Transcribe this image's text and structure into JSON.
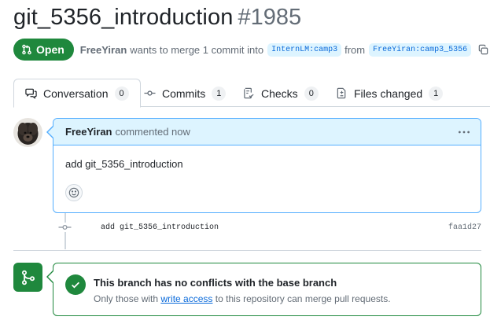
{
  "pr": {
    "title": "git_5356_introduction",
    "number": "#1985",
    "state": "Open",
    "author": "FreeYiran",
    "merge_text": "wants to merge 1 commit into",
    "base_branch": "InternLM:camp3",
    "from_text": "from",
    "head_branch": "FreeYiran:camp3_5356"
  },
  "tabs": [
    {
      "label": "Conversation",
      "count": "0"
    },
    {
      "label": "Commits",
      "count": "1"
    },
    {
      "label": "Checks",
      "count": "0"
    },
    {
      "label": "Files changed",
      "count": "1"
    }
  ],
  "comment": {
    "author": "FreeYiran",
    "action": "commented now",
    "body": "add git_5356_introduction"
  },
  "commit": {
    "message": "add git_5356_introduction",
    "sha": "faa1d27"
  },
  "merge": {
    "title": "This branch has no conflicts with the base branch",
    "sub_before": "Only those with",
    "sub_link": "write access",
    "sub_after": "to this repository can merge pull requests."
  },
  "colors": {
    "open_green": "#1f883d",
    "link_blue": "#0969da",
    "comment_header_bg": "#ddf4ff"
  }
}
